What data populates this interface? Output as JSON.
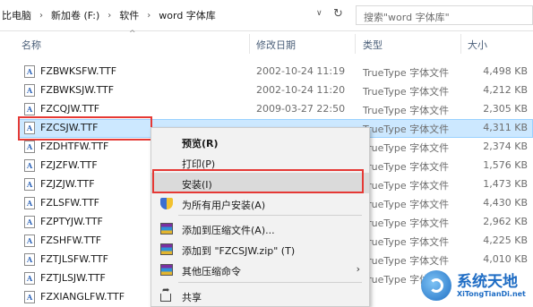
{
  "breadcrumb": [
    "比电脑",
    "新加卷 (F:)",
    "软件",
    "word  字体库"
  ],
  "search": {
    "placeholder": "搜索\"word  字体库\""
  },
  "columns": {
    "name": "名称",
    "modified": "修改日期",
    "type": "类型",
    "size": "大小"
  },
  "files": [
    {
      "name": "FZBWKSFW.TTF",
      "date": "2002-10-24 11:19",
      "type": "TrueType 字体文件",
      "size": "4,498 KB"
    },
    {
      "name": "FZBWKSJW.TTF",
      "date": "2002-10-24 11:20",
      "type": "TrueType 字体文件",
      "size": "4,212 KB"
    },
    {
      "name": "FZCQJW.TTF",
      "date": "2009-03-27 22:50",
      "type": "TrueType 字体文件",
      "size": "2,305 KB"
    },
    {
      "name": "FZCSJW.TTF",
      "date": "",
      "type": "TrueType 字体文件",
      "size": "4,311 KB",
      "selected": true
    },
    {
      "name": "FZDHTFW.TTF",
      "date": "",
      "type": "TrueType 字体文件",
      "size": "2,374 KB"
    },
    {
      "name": "FZJZFW.TTF",
      "date": "",
      "type": "TrueType 字体文件",
      "size": "1,576 KB"
    },
    {
      "name": "FZJZJW.TTF",
      "date": "",
      "type": "TrueType 字体文件",
      "size": "1,473 KB"
    },
    {
      "name": "FZLSFW.TTF",
      "date": "",
      "type": "TrueType 字体文件",
      "size": "4,430 KB"
    },
    {
      "name": "FZPTYJW.TTF",
      "date": "",
      "type": "TrueType 字体文件",
      "size": "2,962 KB"
    },
    {
      "name": "FZSHFW.TTF",
      "date": "",
      "type": "TrueType 字体文件",
      "size": "4,225 KB"
    },
    {
      "name": "FZTJLSFW.TTF",
      "date": "",
      "type": "TrueType 字体文件",
      "size": "4,010 KB"
    },
    {
      "name": "FZTJLSJW.TTF",
      "date": "",
      "type": "TrueType 字体文件",
      "size": ""
    },
    {
      "name": "FZXIANGLFW.TTF",
      "date": "",
      "type": "",
      "size": ""
    }
  ],
  "context_menu": [
    {
      "label": "预览(R)",
      "icon": "",
      "bold": true
    },
    {
      "label": "打印(P)",
      "icon": ""
    },
    {
      "label": "安装(I)",
      "icon": "",
      "hover": true
    },
    {
      "label": "为所有用户安装(A)",
      "icon": "shield-icon"
    },
    {
      "label": "添加到压缩文件(A)...",
      "icon": "archive-icon"
    },
    {
      "label": "添加到 \"FZCSJW.zip\" (T)",
      "icon": "archive-icon"
    },
    {
      "label": "其他压缩命令",
      "icon": "archive-icon",
      "submenu": true
    },
    {
      "label": "共享",
      "icon": "share-icon"
    }
  ],
  "watermark": {
    "title": "系统天地",
    "subtitle": "XiTongTianDi.net"
  },
  "colors": {
    "selection": "#cce8ff",
    "highlight_box": "#e53935",
    "menu_bg": "#f2f2f2"
  }
}
